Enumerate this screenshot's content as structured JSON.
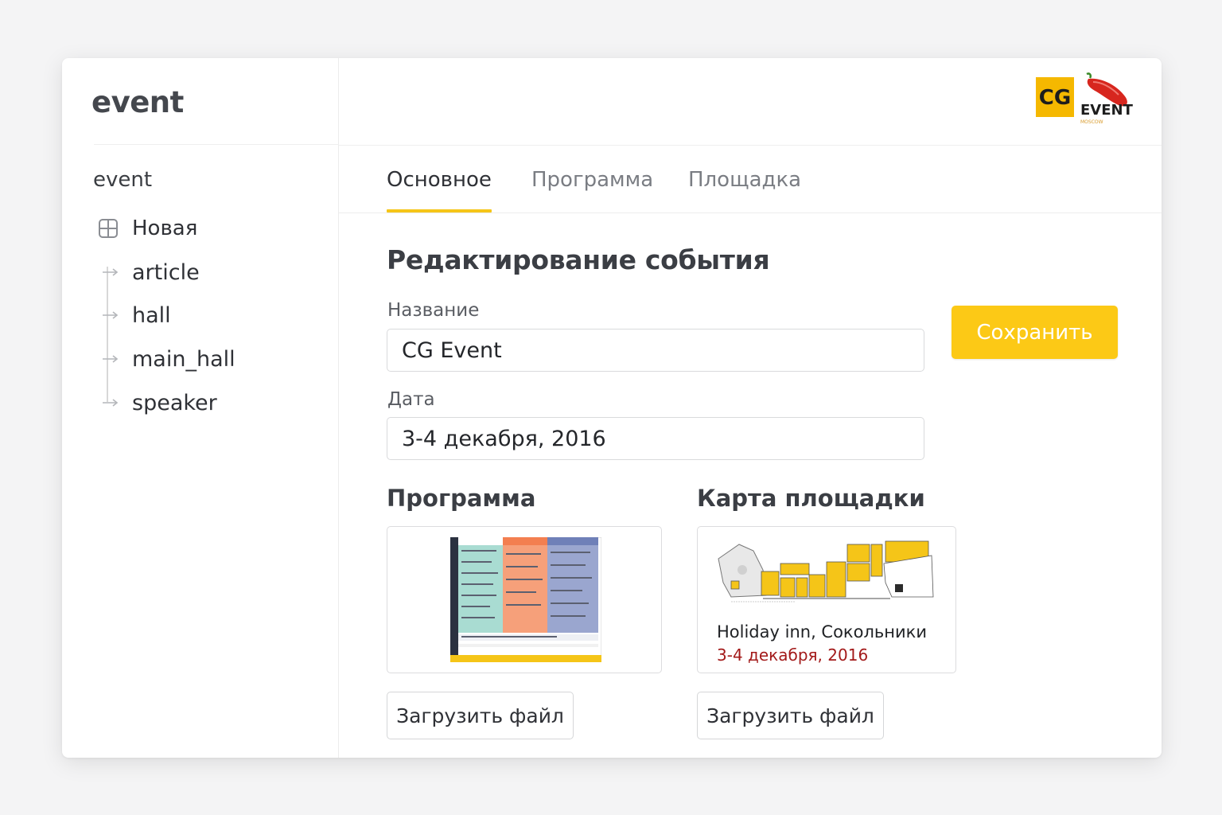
{
  "app": {
    "title": "event"
  },
  "sidebar": {
    "section": "event",
    "new_label": "Новая",
    "items": [
      {
        "label": "article"
      },
      {
        "label": "hall"
      },
      {
        "label": "main_hall"
      },
      {
        "label": "speaker"
      }
    ]
  },
  "logo": {
    "initials": "CG",
    "word": "EVENT",
    "city": "MOSCOW"
  },
  "tabs": [
    {
      "label": "Основное",
      "active": true
    },
    {
      "label": "Программа",
      "active": false
    },
    {
      "label": "Площадка",
      "active": false
    }
  ],
  "form": {
    "title": "Редактирование события",
    "name_label": "Название",
    "name_value": "CG Event",
    "date_label": "Дата",
    "date_value": "3-4 декабря, 2016",
    "save_label": "Сохранить"
  },
  "program": {
    "title": "Программа",
    "upload_label": "Загрузить файл"
  },
  "venue": {
    "title": "Карта площадки",
    "name": "Holiday inn, Сокольники",
    "date": "3-4 декабря, 2016",
    "upload_label": "Загрузить файл"
  },
  "colors": {
    "accent": "#fcc916",
    "logo_yellow": "#f5b800",
    "pepper_red": "#d7261e",
    "venue_date": "#a31a1a",
    "program_col1": "#a9dcd2",
    "program_col2": "#f6a07a",
    "program_col3": "#9aa6cf"
  }
}
